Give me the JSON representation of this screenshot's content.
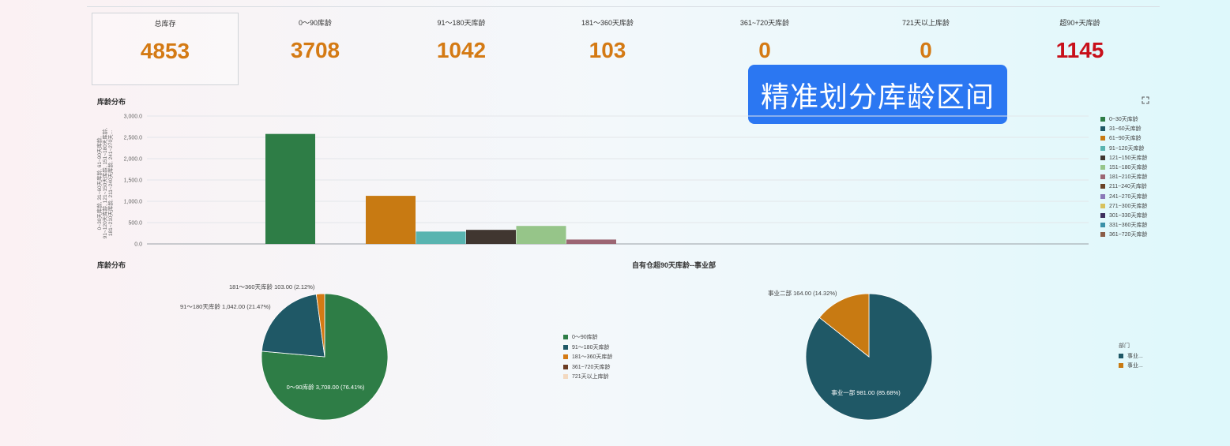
{
  "kpis": [
    {
      "label": "总库存",
      "value": "4853",
      "color": "#d47a14"
    },
    {
      "label": "0～90库龄",
      "value": "3708",
      "color": "#d47a14"
    },
    {
      "label": "91～180天库龄",
      "value": "1042",
      "color": "#d47a14"
    },
    {
      "label": "181～360天库龄",
      "value": "103",
      "color": "#d47a14"
    },
    {
      "label": "361~720天库龄",
      "value": "0",
      "color": "#d47a14"
    },
    {
      "label": "721天以上库龄",
      "value": "0",
      "color": "#d47a14"
    },
    {
      "label": "超90+天库龄",
      "value": "1145",
      "color": "#c8101a"
    }
  ],
  "badge": "精准划分库龄区间",
  "bar_section": {
    "title": "库龄分布",
    "icon": "expand-icon",
    "ylabel_lines": [
      "0~30天库龄, 31~60天库龄, 61~90天库龄,",
      "91~120天库龄, 121~150天库龄, 151~180天库龄,",
      "181~210天库龄, 211~240天库龄, 241~270天..."
    ],
    "legend": [
      {
        "name": "0~30天库龄",
        "color": "#2e7d46"
      },
      {
        "name": "31~60天库龄",
        "color": "#1f5866"
      },
      {
        "name": "61~90天库龄",
        "color": "#c87a12"
      },
      {
        "name": "91~120天库龄",
        "color": "#58b4b0"
      },
      {
        "name": "121~150天库龄",
        "color": "#403630"
      },
      {
        "name": "151~180天库龄",
        "color": "#96c589"
      },
      {
        "name": "181~210天库龄",
        "color": "#9c6673"
      },
      {
        "name": "211~240天库龄",
        "color": "#6a4226"
      },
      {
        "name": "241~270天库龄",
        "color": "#8b79b8"
      },
      {
        "name": "271~300天库龄",
        "color": "#d8c25d"
      },
      {
        "name": "301~330天库龄",
        "color": "#3c2e5c"
      },
      {
        "name": "331~360天库龄",
        "color": "#3b91a8"
      },
      {
        "name": "361~720天库龄",
        "color": "#8b5e48"
      }
    ]
  },
  "pie1_section": {
    "title": "库龄分布",
    "legend": [
      {
        "name": "0～90库龄",
        "color": "#2e7d46"
      },
      {
        "name": "91～180天库龄",
        "color": "#1f5866"
      },
      {
        "name": "181～360天库龄",
        "color": "#d47a14"
      },
      {
        "name": "361~720天库龄",
        "color": "#6b3b22"
      },
      {
        "name": "721天以上库龄",
        "color": "#f3d9c0"
      }
    ]
  },
  "pie2_section": {
    "title": "自有仓超90天库龄--事业部",
    "legend_title": "部门",
    "legend": [
      {
        "name": "事业...",
        "color": "#1f5866"
      },
      {
        "name": "事业...",
        "color": "#c87a12"
      }
    ]
  },
  "chart_data": [
    {
      "type": "bar",
      "title": "库龄分布",
      "ylim": [
        0,
        3000
      ],
      "yticks": [
        "0.0",
        "500.0",
        "1,000.0",
        "1,500.0",
        "2,000.0",
        "2,500.0",
        "3,000.0"
      ],
      "grid": true,
      "legend_position": "right",
      "series": [
        {
          "name": "0~30天库龄",
          "value": 2580
        },
        {
          "name": "31~60天库龄",
          "value": 0
        },
        {
          "name": "61~90天库龄",
          "value": 1128
        },
        {
          "name": "91~120天库龄",
          "value": 290
        },
        {
          "name": "121~150天库龄",
          "value": 330
        },
        {
          "name": "151~180天库龄",
          "value": 422
        },
        {
          "name": "181~210天库龄",
          "value": 103
        }
      ]
    },
    {
      "type": "pie",
      "title": "库龄分布",
      "slices": [
        {
          "name": "0～90库龄",
          "value": 3708,
          "label": "0～90库龄 3,708.00 (76.41%)"
        },
        {
          "name": "91～180天库龄",
          "value": 1042,
          "label": "91～180天库龄 1,042.00 (21.47%)"
        },
        {
          "name": "181～360天库龄",
          "value": 103,
          "label": "181～360天库龄 103.00 (2.12%)"
        }
      ]
    },
    {
      "type": "pie",
      "title": "自有仓超90天库龄--事业部",
      "slices": [
        {
          "name": "事业一部",
          "value": 981,
          "label": "事业一部 981.00 (85.68%)"
        },
        {
          "name": "事业二部",
          "value": 164,
          "label": "事业二部 164.00 (14.32%)"
        }
      ]
    }
  ]
}
